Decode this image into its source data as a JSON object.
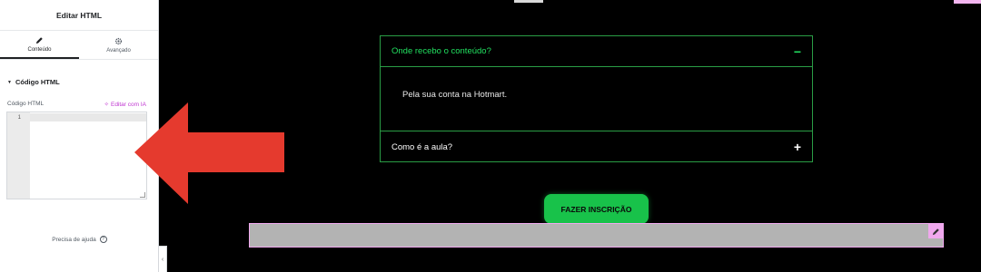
{
  "panel": {
    "title": "Editar HTML",
    "tabs": [
      {
        "label": "Conteúdo",
        "icon": "pencil-icon",
        "active": true
      },
      {
        "label": "Avançado",
        "icon": "gear-icon",
        "active": false
      }
    ],
    "section_title": "Código HTML",
    "field_label": "Código HTML",
    "ai_link": "Editar com IA",
    "code_editor": {
      "line_number": "1",
      "content": ""
    },
    "help_text": "Precisa de ajuda",
    "help_icon": "?",
    "collapse_icon": "‹"
  },
  "preview": {
    "accordion": [
      {
        "question": "Onde recebo o conteúdo?",
        "answer": "Pela sua conta na Hotmart.",
        "expanded": true,
        "icon": "−"
      },
      {
        "question": "Como é a aula?",
        "expanded": false,
        "icon": "+"
      }
    ],
    "cta_label": "FAZER INSCRIÇÃO"
  },
  "annotation": {
    "type": "red-arrow-pointing-left"
  },
  "colors": {
    "accent_green": "#22e060",
    "border_green": "#2a9d45",
    "button_green": "#18c24a",
    "ai_pink": "#c036d1",
    "arrow_red": "#e53a2e"
  }
}
